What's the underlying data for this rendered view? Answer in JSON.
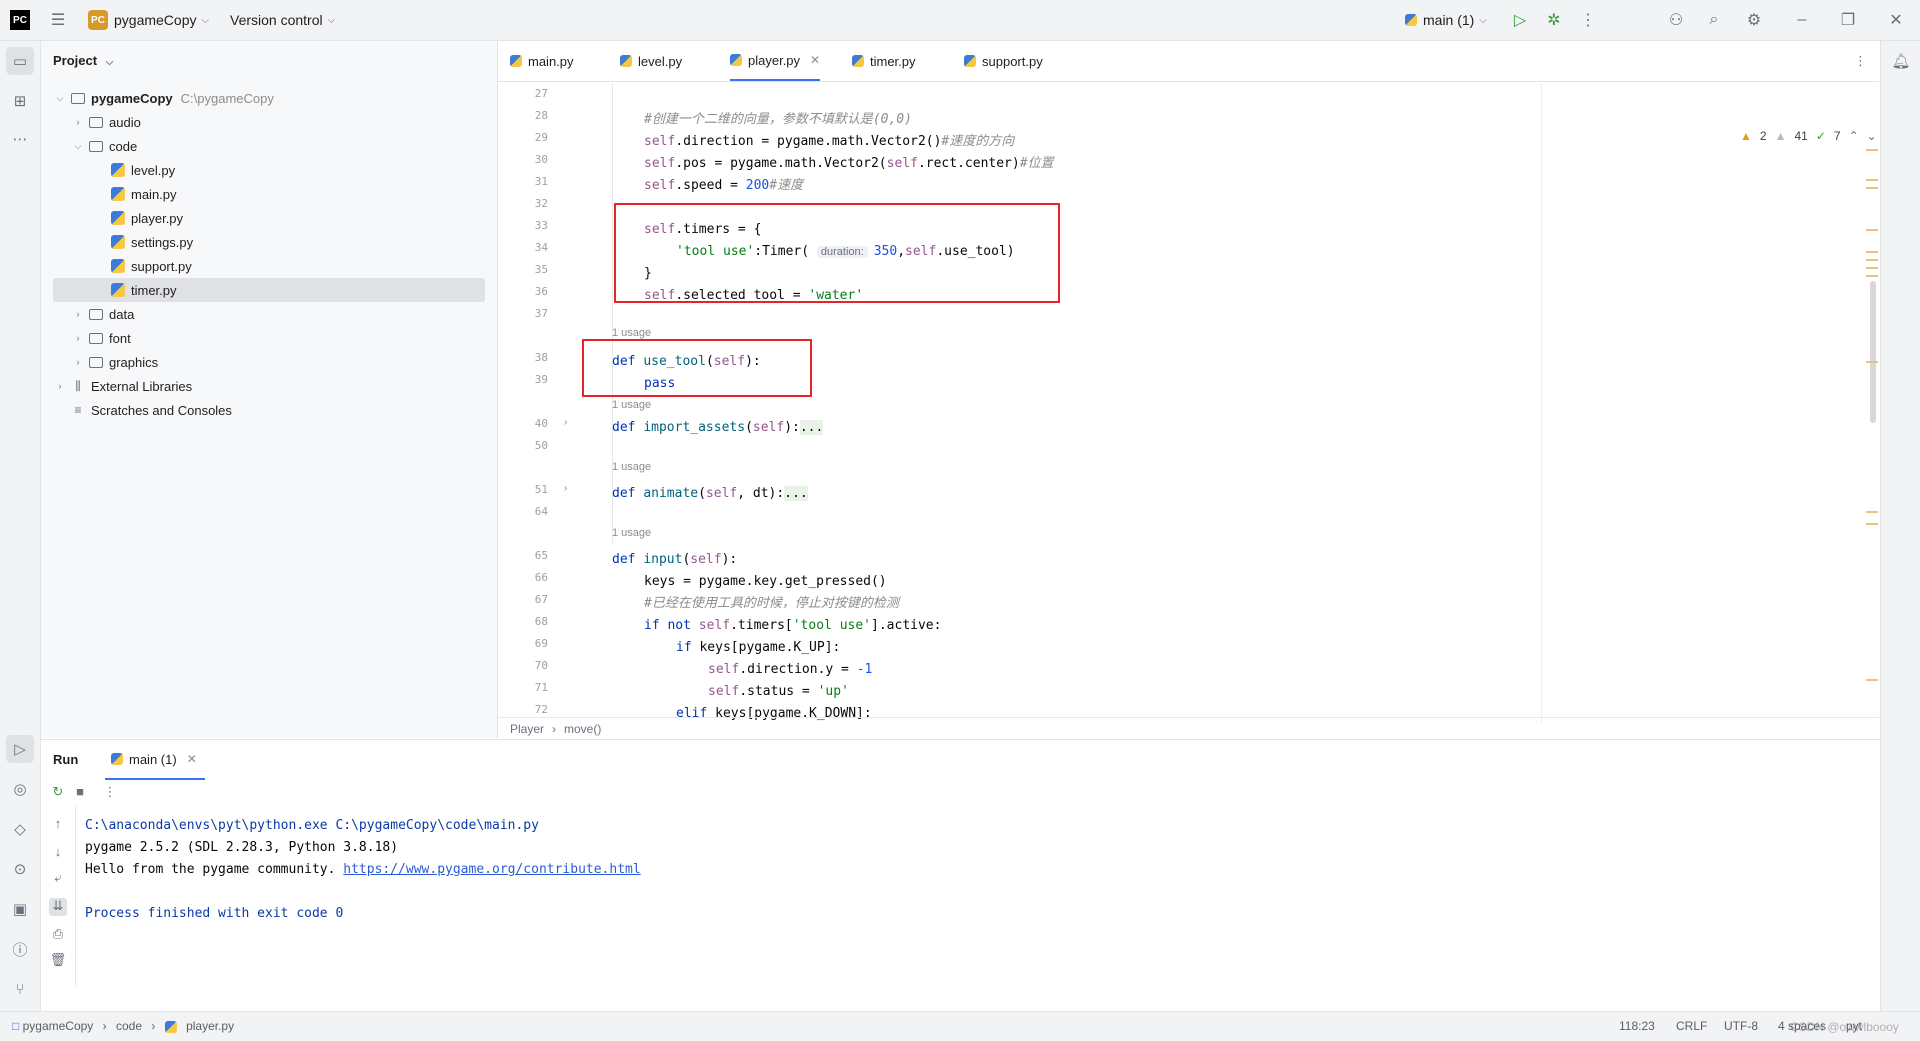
{
  "titlebar": {
    "logo": "PC",
    "project_badge": "PC",
    "project_name": "pygameCopy",
    "vcs_label": "Version control",
    "run_config": "main (1)"
  },
  "project_panel": {
    "title": "Project",
    "root": {
      "name": "pygameCopy",
      "path": "C:\\pygameCopy"
    },
    "items": [
      {
        "label": "audio"
      },
      {
        "label": "code"
      },
      {
        "label": "level.py"
      },
      {
        "label": "main.py"
      },
      {
        "label": "player.py"
      },
      {
        "label": "settings.py"
      },
      {
        "label": "support.py"
      },
      {
        "label": "timer.py"
      },
      {
        "label": "data"
      },
      {
        "label": "font"
      },
      {
        "label": "graphics"
      },
      {
        "label": "External Libraries"
      },
      {
        "label": "Scratches and Consoles"
      }
    ]
  },
  "tabs": [
    {
      "label": "main.py"
    },
    {
      "label": "level.py"
    },
    {
      "label": "player.py"
    },
    {
      "label": "timer.py"
    },
    {
      "label": "support.py"
    }
  ],
  "inspections": {
    "warnings_a": "2",
    "warnings_b": "41",
    "ok": "7"
  },
  "code": {
    "line_numbers": [
      "27",
      "28",
      "29",
      "30",
      "31",
      "32",
      "33",
      "34",
      "35",
      "36",
      "37",
      "38",
      "39",
      "40",
      "50",
      "51",
      "64",
      "65",
      "66",
      "67",
      "68",
      "69",
      "70",
      "71",
      "72"
    ],
    "usage_label": "1 usage",
    "comment_28": "#创建一个二维的向量，参数不填默认是(0,0)",
    "comment_29": "#速度的方向",
    "comment_30": "#位置",
    "comment_31": "#速度",
    "comment_67": "#已经在使用工具的时候，停止对按键的检测",
    "hint_duration": "duration:",
    "num_350": "350",
    "num_200": "200",
    "num_neg1": "-1",
    "str_tool_use": "'tool use'",
    "str_water": "'water'",
    "str_up": "'up'",
    "fold_dots": "..."
  },
  "breadcrumb": {
    "cls": "Player",
    "method": "move()"
  },
  "run_panel": {
    "title": "Run",
    "tab": "main (1)",
    "output": [
      "C:\\anaconda\\envs\\pyt\\python.exe C:\\pygameCopy\\code\\main.py",
      "pygame 2.5.2 (SDL 2.28.3, Python 3.8.18)",
      "Hello from the pygame community. "
    ],
    "link": "https://www.pygame.org/contribute.html",
    "exit": "Process finished with exit code 0"
  },
  "statusbar": {
    "crumb_project": "pygameCopy",
    "crumb_code": "code",
    "crumb_file": "player.py",
    "position": "118:23",
    "line_sep": "CRLF",
    "encoding": "UTF-8",
    "indent": "4 spaces",
    "interpreter": "pyt",
    "watermark": "CSDN @owwlboooy"
  }
}
